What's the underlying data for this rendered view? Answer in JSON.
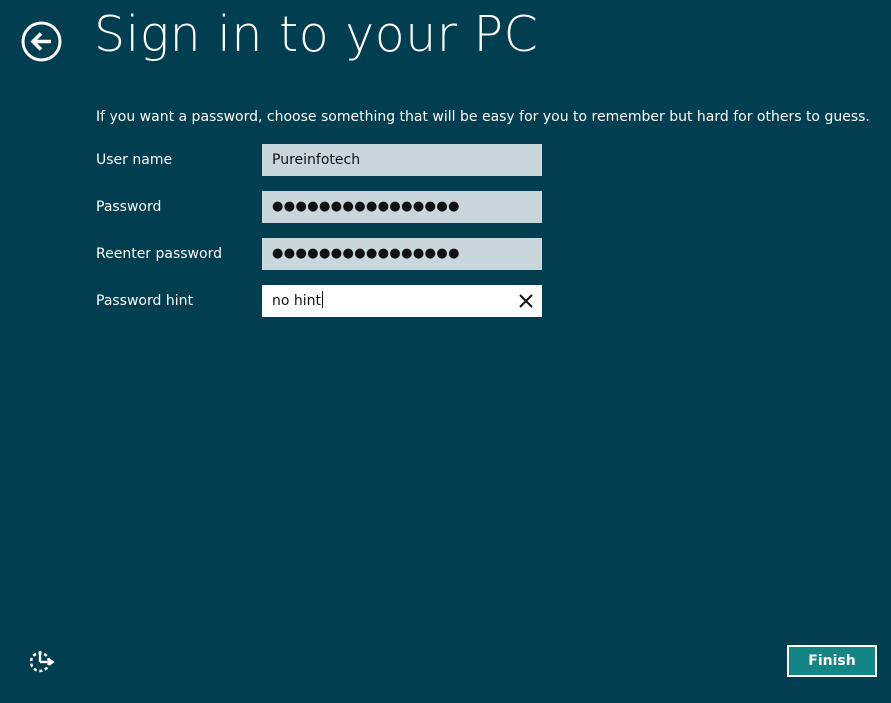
{
  "header": {
    "title": "Sign in to your PC",
    "back_icon": "back-arrow-circle-icon"
  },
  "instruction": "If you want a password, choose something that will be easy for you to remember but hard for others to guess.",
  "form": {
    "username": {
      "label": "User name",
      "value": "Pureinfotech"
    },
    "password": {
      "label": "Password",
      "value": "●●●●●●●●●●●●●●●●"
    },
    "reenter_password": {
      "label": "Reenter password",
      "value": "●●●●●●●●●●●●●●●●"
    },
    "password_hint": {
      "label": "Password hint",
      "value": "no hint",
      "clear_icon": "close-icon"
    }
  },
  "footer": {
    "ease_of_access_icon": "ease-of-access-icon",
    "finish_label": "Finish"
  },
  "colors": {
    "background": "#003e50",
    "field_background": "#c9d6dc",
    "focused_field_background": "#ffffff",
    "button_background": "#138585",
    "text": "#ffffff"
  }
}
